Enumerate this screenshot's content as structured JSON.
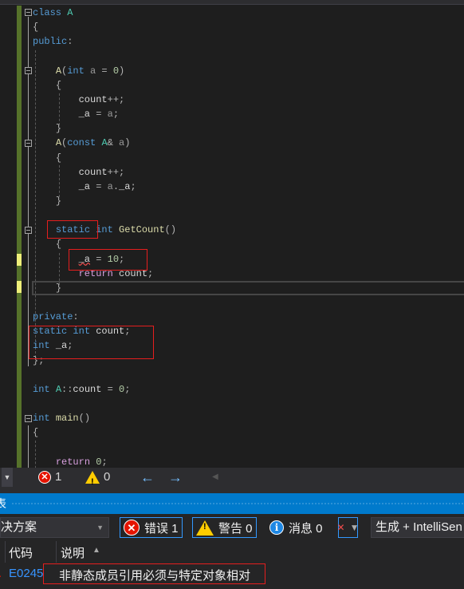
{
  "editor": {
    "lines": [
      {
        "t": [
          [
            "class",
            "kw"
          ],
          [
            " "
          ],
          [
            "A",
            "ty"
          ]
        ]
      },
      {
        "t": [
          [
            "{",
            "pu"
          ]
        ]
      },
      {
        "t": [
          [
            "public",
            "kw"
          ],
          [
            ":",
            "pu"
          ]
        ]
      },
      {
        "t": []
      },
      {
        "t": [
          [
            "    "
          ],
          [
            "A",
            "fn"
          ],
          [
            "(",
            "pu"
          ],
          [
            "int",
            "kw"
          ],
          [
            " "
          ],
          [
            "a",
            "pm"
          ],
          [
            " = ",
            "pu"
          ],
          [
            "0",
            "nm"
          ],
          [
            ")",
            "pu"
          ]
        ]
      },
      {
        "t": [
          [
            "    "
          ],
          [
            "{",
            "pu"
          ]
        ]
      },
      {
        "t": [
          [
            "        "
          ],
          [
            "count",
            "vr"
          ],
          [
            "++;",
            "pu"
          ]
        ]
      },
      {
        "t": [
          [
            "        "
          ],
          [
            "_a",
            "vr"
          ],
          [
            " = ",
            "pu"
          ],
          [
            "a",
            "pm"
          ],
          [
            ";",
            "pu"
          ]
        ]
      },
      {
        "t": [
          [
            "    "
          ],
          [
            "}",
            "pu"
          ]
        ]
      },
      {
        "t": [
          [
            "    "
          ],
          [
            "A",
            "fn"
          ],
          [
            "(",
            "pu"
          ],
          [
            "const",
            "kw"
          ],
          [
            " "
          ],
          [
            "A",
            "ty"
          ],
          [
            "&",
            "pu"
          ],
          [
            " "
          ],
          [
            "a",
            "pm"
          ],
          [
            ")",
            "pu"
          ]
        ]
      },
      {
        "t": [
          [
            "    "
          ],
          [
            "{",
            "pu"
          ]
        ]
      },
      {
        "t": [
          [
            "        "
          ],
          [
            "count",
            "vr"
          ],
          [
            "++;",
            "pu"
          ]
        ]
      },
      {
        "t": [
          [
            "        "
          ],
          [
            "_a",
            "vr"
          ],
          [
            " = ",
            "pu"
          ],
          [
            "a",
            "pm"
          ],
          [
            ".",
            "pu"
          ],
          [
            "_a",
            "vr"
          ],
          [
            ";",
            "pu"
          ]
        ]
      },
      {
        "t": [
          [
            "    "
          ],
          [
            "}",
            "pu"
          ]
        ]
      },
      {
        "t": []
      },
      {
        "t": [
          [
            "    "
          ],
          [
            "static",
            "kw"
          ],
          [
            " "
          ],
          [
            "int",
            "kw"
          ],
          [
            " "
          ],
          [
            "GetCount",
            "fn"
          ],
          [
            "()",
            "pu"
          ]
        ]
      },
      {
        "t": [
          [
            "    "
          ],
          [
            "{",
            "pu"
          ]
        ]
      },
      {
        "t": [
          [
            "        "
          ],
          [
            "_a",
            "vr err"
          ],
          [
            " = ",
            "pu"
          ],
          [
            "10",
            "nm"
          ],
          [
            ";",
            "pu"
          ]
        ]
      },
      {
        "t": [
          [
            "        "
          ],
          [
            "return",
            "rt"
          ],
          [
            " "
          ],
          [
            "count",
            "vr"
          ],
          [
            ";",
            "pu"
          ]
        ]
      },
      {
        "t": [
          [
            "    "
          ],
          [
            "}",
            "pu"
          ]
        ]
      },
      {
        "t": []
      },
      {
        "t": [
          [
            "private",
            "kw"
          ],
          [
            ":",
            "pu"
          ]
        ]
      },
      {
        "t": [
          [
            "static",
            "kw"
          ],
          [
            " "
          ],
          [
            "int",
            "kw"
          ],
          [
            " "
          ],
          [
            "count",
            "vr"
          ],
          [
            ";",
            "pu"
          ]
        ]
      },
      {
        "t": [
          [
            "int",
            "kw"
          ],
          [
            " "
          ],
          [
            "_a",
            "vr"
          ],
          [
            ";",
            "pu"
          ]
        ]
      },
      {
        "t": [
          [
            "};",
            "pu"
          ]
        ]
      },
      {
        "t": []
      },
      {
        "t": [
          [
            "int",
            "kw"
          ],
          [
            " "
          ],
          [
            "A",
            "ty"
          ],
          [
            "::",
            "pu"
          ],
          [
            "count",
            "vr"
          ],
          [
            " = ",
            "pu"
          ],
          [
            "0",
            "nm"
          ],
          [
            ";",
            "pu"
          ]
        ]
      },
      {
        "t": []
      },
      {
        "t": [
          [
            "int",
            "kw"
          ],
          [
            " "
          ],
          [
            "main",
            "fn"
          ],
          [
            "()",
            "pu"
          ]
        ]
      },
      {
        "t": [
          [
            "{",
            "pu"
          ]
        ]
      },
      {
        "t": []
      },
      {
        "t": [
          [
            "    "
          ],
          [
            "return",
            "rt"
          ],
          [
            " "
          ],
          [
            "0",
            "nm"
          ],
          [
            ";",
            "pu"
          ]
        ]
      }
    ]
  },
  "statusbar": {
    "errors": "1",
    "warnings": "0",
    "back_icon": "arrow-left-icon",
    "forward_icon": "arrow-right-icon"
  },
  "error_list": {
    "title_fragment": "表",
    "scope_select": "决方案",
    "errors_btn": "错误 1",
    "warnings_btn": "警告 0",
    "messages_btn": "消息 0",
    "source_select": "生成 + IntelliSen",
    "col_code": "代码",
    "col_desc": "说明",
    "rows": [
      {
        "code": "E0245",
        "desc": "非静态成员引用必须与特定对象相对"
      }
    ]
  },
  "colors": {
    "accent": "#007acc",
    "error": "#e51400",
    "warning": "#ffcc00",
    "highlight_box": "#e51e1e"
  }
}
